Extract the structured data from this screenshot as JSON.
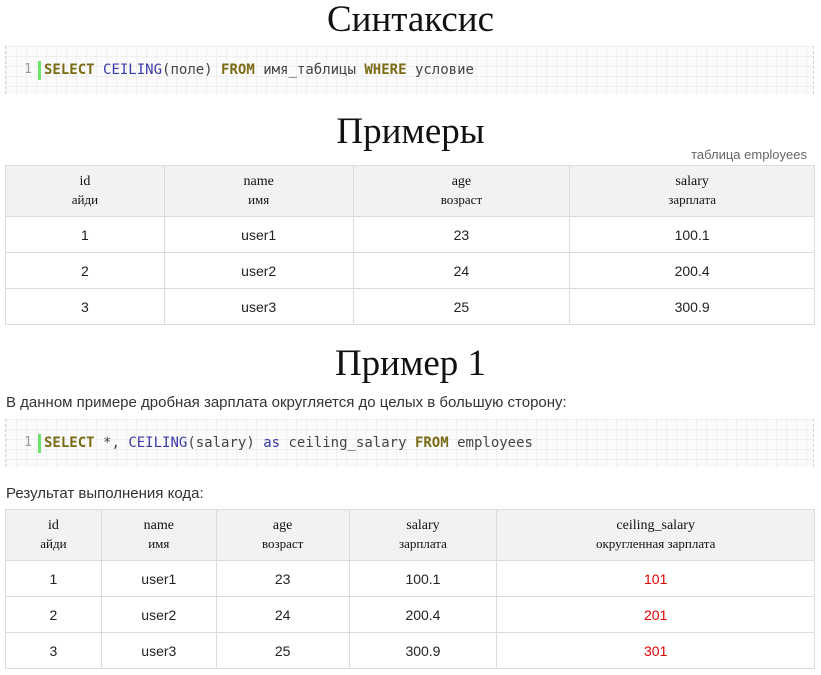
{
  "headings": {
    "syntax": "Синтаксис",
    "examples": "Примеры",
    "example1": "Пример 1"
  },
  "syntax_code": {
    "line_number": "1",
    "tokens": [
      "SELECT",
      "CEILING",
      "(поле)",
      "FROM",
      "имя_таблицы",
      "WHERE",
      "условие"
    ]
  },
  "table_caption": "таблица employees",
  "employees_table": {
    "headers": [
      {
        "name": "id",
        "sub": "айди"
      },
      {
        "name": "name",
        "sub": "имя"
      },
      {
        "name": "age",
        "sub": "возраст"
      },
      {
        "name": "salary",
        "sub": "зарплата"
      }
    ],
    "rows": [
      [
        "1",
        "user1",
        "23",
        "100.1"
      ],
      [
        "2",
        "user2",
        "24",
        "200.4"
      ],
      [
        "3",
        "user3",
        "25",
        "300.9"
      ]
    ]
  },
  "example1_description": "В данном примере дробная зарплата округляется до целых в большую сторону:",
  "example1_code": {
    "line_number": "1",
    "tokens": [
      "SELECT",
      "*,",
      "CEILING",
      "(salary)",
      "as",
      "ceiling_salary",
      "FROM",
      "employees"
    ]
  },
  "result_label": "Результат выполнения кода:",
  "result_table": {
    "headers": [
      {
        "name": "id",
        "sub": "айди"
      },
      {
        "name": "name",
        "sub": "имя"
      },
      {
        "name": "age",
        "sub": "возраст"
      },
      {
        "name": "salary",
        "sub": "зарплата"
      },
      {
        "name": "ceiling_salary",
        "sub": "округленная зарплата"
      }
    ],
    "rows": [
      [
        "1",
        "user1",
        "23",
        "100.1",
        "101"
      ],
      [
        "2",
        "user2",
        "24",
        "200.4",
        "201"
      ],
      [
        "3",
        "user3",
        "25",
        "300.9",
        "301"
      ]
    ]
  },
  "colors": {
    "keyword": "#7a6b14",
    "function": "#3a3aa8",
    "highlight": "#e00000",
    "gutter_bar": "#6ce26c"
  }
}
